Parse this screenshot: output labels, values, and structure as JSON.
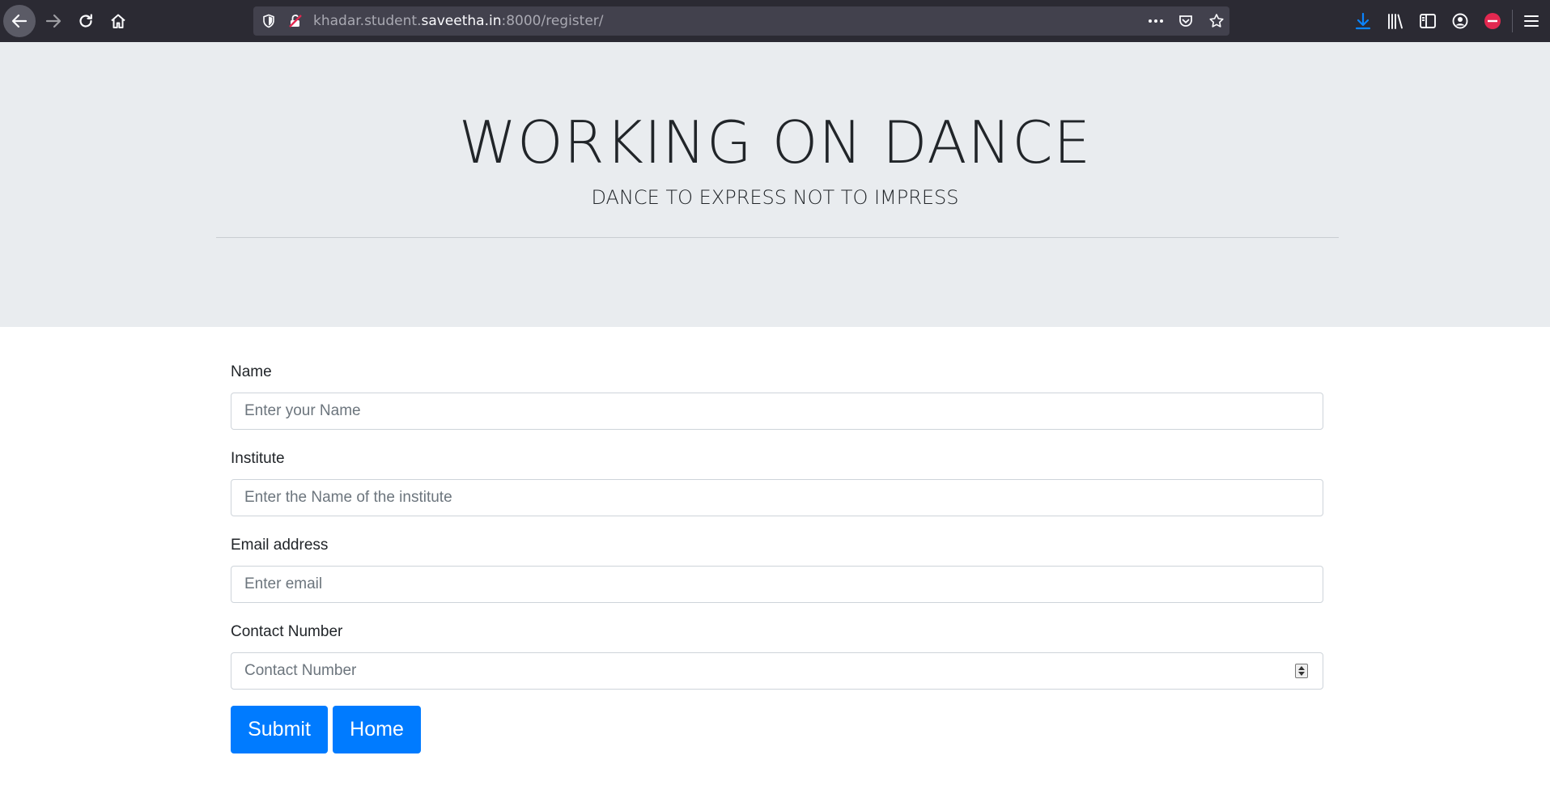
{
  "browser": {
    "url_prefix": "khadar.student.",
    "url_domain": "saveetha.in",
    "url_suffix": ":8000/register/",
    "more_label": "•••"
  },
  "jumbotron": {
    "title": "WORKING ON DANCE",
    "subtitle": "DANCE TO EXPRESS NOT TO IMPRESS"
  },
  "form": {
    "name_label": "Name",
    "name_placeholder": "Enter your Name",
    "institute_label": "Institute",
    "institute_placeholder": "Enter the Name of the institute",
    "email_label": "Email address",
    "email_placeholder": "Enter email",
    "contact_label": "Contact Number",
    "contact_placeholder": "Contact Number",
    "submit_label": "Submit",
    "home_label": "Home"
  },
  "colors": {
    "primary": "#007bff",
    "jumbotron_bg": "#e9ecef",
    "toolbar_bg": "#2b2a33",
    "download_accent": "#0a84ff",
    "pdf_badge": "#e22850"
  },
  "icons": [
    "back-arrow-icon",
    "forward-arrow-icon",
    "reload-icon",
    "home-icon",
    "shield-icon",
    "insecure-lock-icon",
    "more-actions-icon",
    "pocket-icon",
    "bookmark-star-icon",
    "download-icon",
    "library-icon",
    "sidebar-icon",
    "account-icon",
    "pdf-extension-icon",
    "hamburger-menu-icon"
  ]
}
